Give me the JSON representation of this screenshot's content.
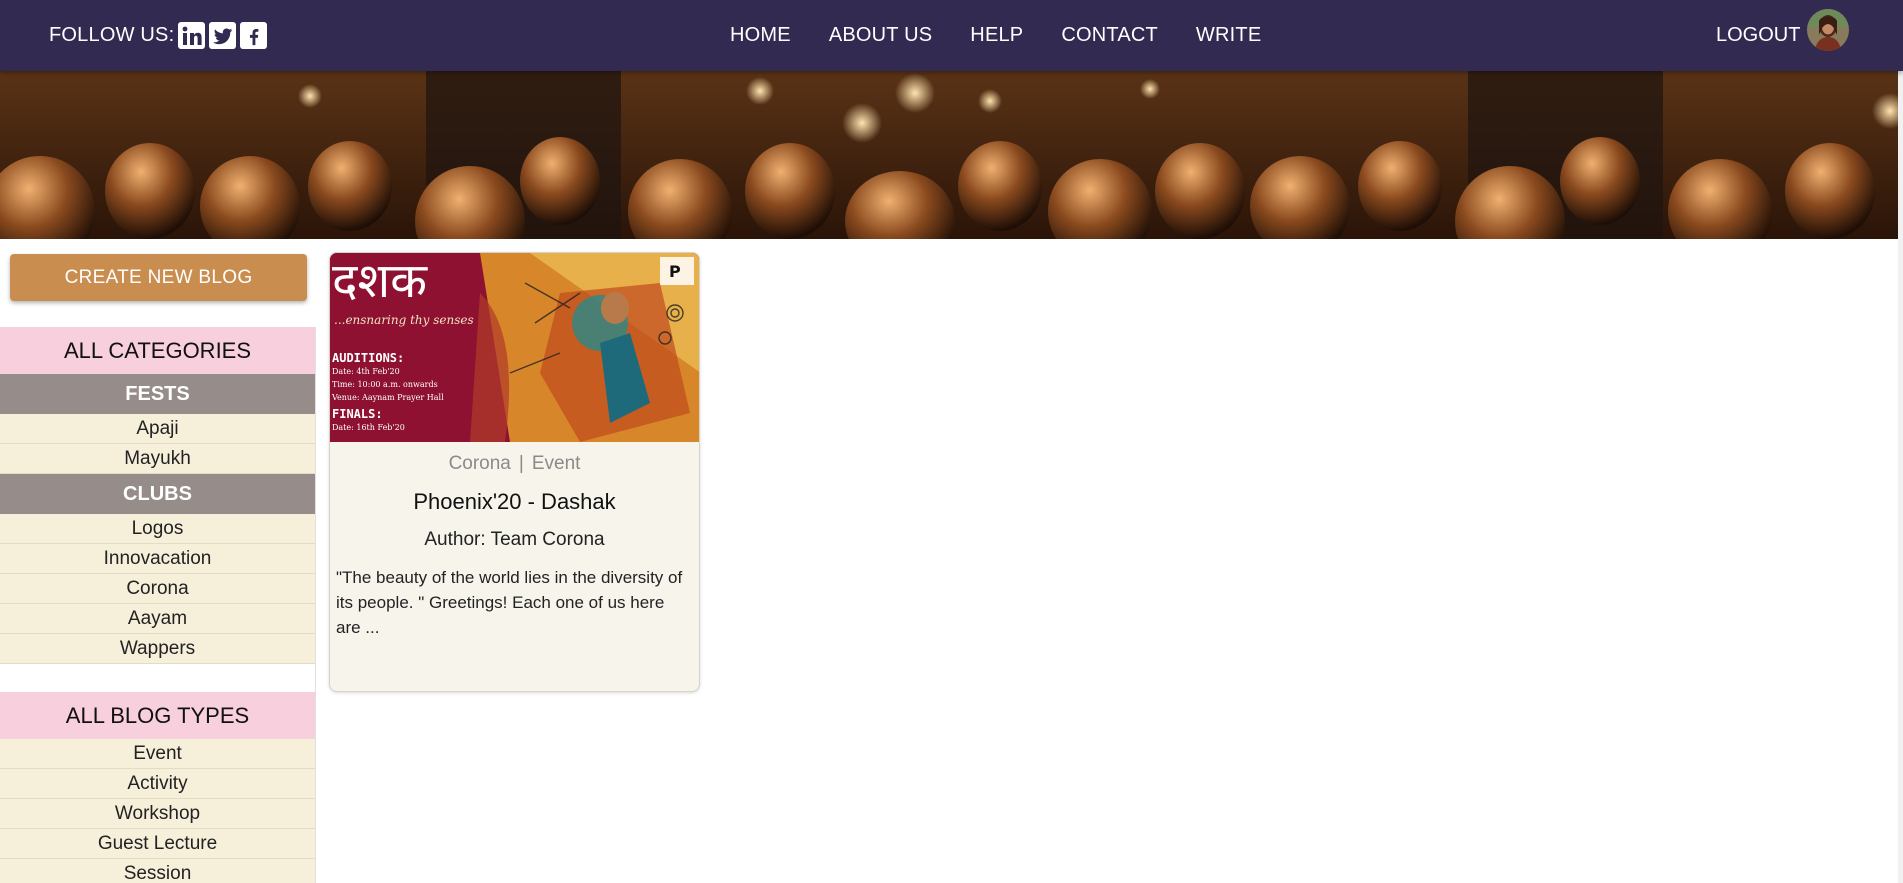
{
  "nav": {
    "follow_label": "FOLLOW US:",
    "social_icons": [
      "linkedin-icon",
      "twitter-icon",
      "facebook-icon"
    ],
    "links": [
      "HOME",
      "ABOUT US",
      "HELP",
      "CONTACT",
      "WRITE"
    ],
    "logout_label": "LOGOUT"
  },
  "sidebar": {
    "create_label": "CREATE NEW BLOG",
    "categories_title": "ALL CATEGORIES",
    "fests_title": "FESTS",
    "fests": [
      "Apaji",
      "Mayukh"
    ],
    "clubs_title": "CLUBS",
    "clubs": [
      "Logos",
      "Innovacation",
      "Corona",
      "Aayam",
      "Wappers"
    ],
    "types_title": "ALL BLOG TYPES",
    "types": [
      "Event",
      "Activity",
      "Workshop",
      "Guest Lecture",
      "Session"
    ]
  },
  "card": {
    "poster": {
      "title_devanagari": "दशक",
      "tagline": "...ensnaring thy senses",
      "auditions_head": "AUDITIONS:",
      "auditions_lines": [
        "Date: 4th Feb'20",
        "Time: 10:00 a.m. onwards",
        "Venue: Aaynam Prayer Hall"
      ],
      "finals_head": "FINALS:",
      "finals_lines": [
        "Date: 16th Feb'20"
      ]
    },
    "club": "Corona",
    "separator": "|",
    "type": "Event",
    "title": "Phoenix'20 - Dashak",
    "author": "Author: Team Corona",
    "excerpt": "\"The beauty of the world lies in the diversity of its people. \" Greetings! Each one of us here are ..."
  },
  "colors": {
    "navbar": "#332a52",
    "accent_button": "#c98e4f",
    "section_header": "#f8cfdc",
    "group_header": "#968c8a",
    "list_item": "#f6f0db",
    "card_bg": "#f7f4ec"
  }
}
